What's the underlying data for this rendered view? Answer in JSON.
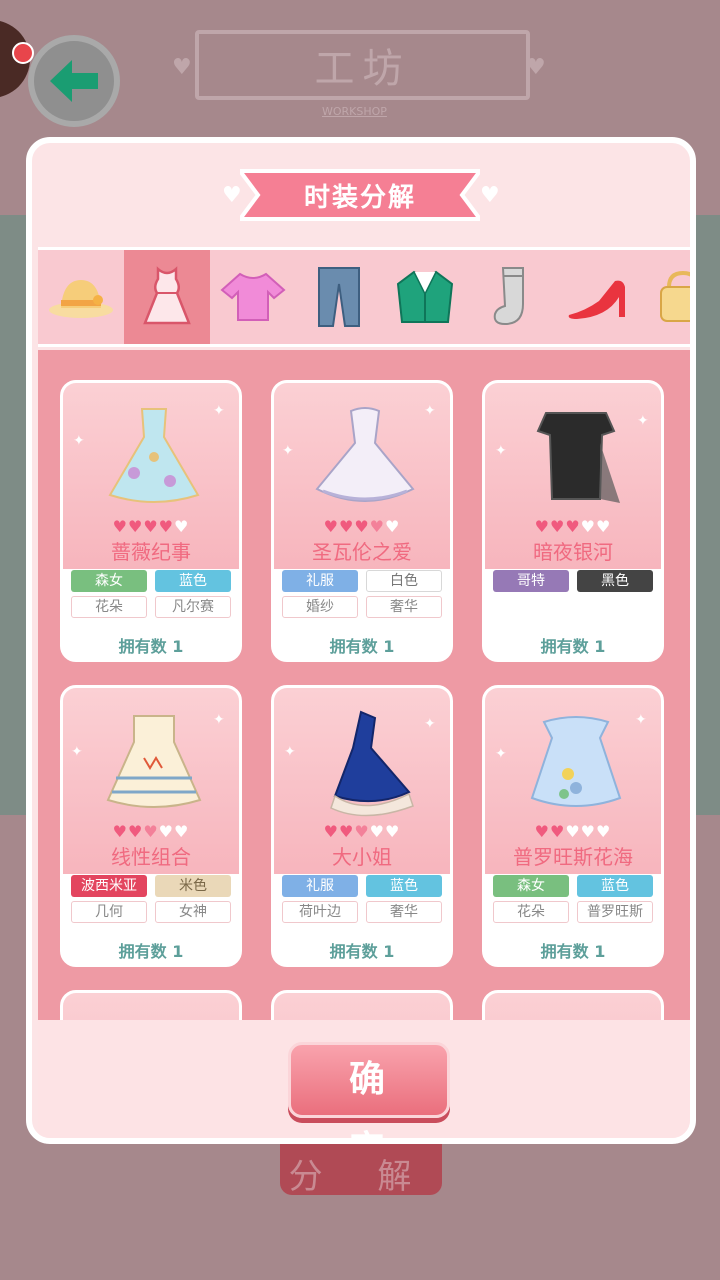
{
  "background": {
    "title": "工坊",
    "subtitle": "WORKSHOP",
    "under_button_label": "分 解"
  },
  "modal": {
    "title": "时装分解",
    "confirm_label": "确 定"
  },
  "tabs": [
    {
      "name": "hat",
      "icon": "hat-icon",
      "active": false
    },
    {
      "name": "dress",
      "icon": "dress-icon",
      "active": true
    },
    {
      "name": "top",
      "icon": "shirt-icon",
      "active": false
    },
    {
      "name": "pants",
      "icon": "pants-icon",
      "active": false
    },
    {
      "name": "coat",
      "icon": "coat-icon",
      "active": false
    },
    {
      "name": "socks",
      "icon": "sock-icon",
      "active": false
    },
    {
      "name": "shoes",
      "icon": "heel-icon",
      "active": false
    },
    {
      "name": "bag",
      "icon": "bag-icon",
      "active": false
    }
  ],
  "items": [
    {
      "name": "蔷薇纪事",
      "rating": 4,
      "tags": [
        "森女",
        "蓝色",
        "花朵",
        "凡尔赛"
      ],
      "owned": "拥有数 1"
    },
    {
      "name": "圣瓦伦之爱",
      "rating": 3.5,
      "tags": [
        "礼服",
        "白色",
        "婚纱",
        "奢华"
      ],
      "owned": "拥有数 1"
    },
    {
      "name": "暗夜银河",
      "rating": 3,
      "tags": [
        "哥特",
        "黑色"
      ],
      "owned": "拥有数 1"
    },
    {
      "name": "线性组合",
      "rating": 2.5,
      "tags": [
        "波西米亚",
        "米色",
        "几何",
        "女神"
      ],
      "owned": "拥有数 1"
    },
    {
      "name": "大小姐",
      "rating": 2.5,
      "tags": [
        "礼服",
        "蓝色",
        "荷叶边",
        "奢华"
      ],
      "owned": "拥有数 1"
    },
    {
      "name": "普罗旺斯花海",
      "rating": 2,
      "tags": [
        "森女",
        "蓝色",
        "花朵",
        "普罗旺斯"
      ],
      "owned": "拥有数 1"
    }
  ],
  "colors": {
    "accent": "#ec8994",
    "panel": "#fce4e6",
    "name_text": "#f06a80",
    "owned_text": "#5d9f9a"
  }
}
